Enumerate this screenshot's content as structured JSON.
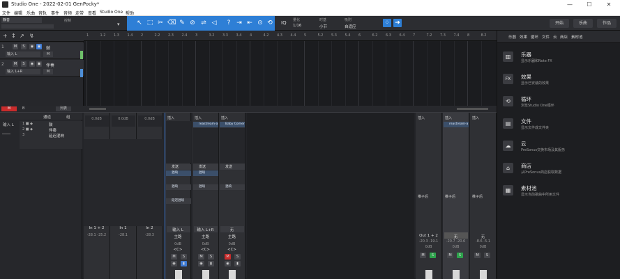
{
  "window": {
    "title": "Studio One - 2022-02-01 GenPocky*",
    "min": "—",
    "max": "☐",
    "close": "✕"
  },
  "menu": [
    "文件",
    "编辑",
    "乐曲",
    "音轨",
    "事件",
    "音频",
    "走带",
    "查看",
    "Studio One",
    "帮助"
  ],
  "toolbar": {
    "preset_name": "静音",
    "control_label": "控制",
    "iq": "IQ",
    "quantize_label": "量化",
    "quantize_val": "1/16",
    "timebase_label": "时基",
    "timebase_val": "小节",
    "snap_label": "吸附",
    "snap_val": "自适应",
    "start": "开始",
    "song": "乐曲",
    "project": "作品"
  },
  "tracks": [
    {
      "num": "1",
      "name": "鼓",
      "input": "输入 L",
      "mode": "M"
    },
    {
      "num": "2",
      "name": "伴奏",
      "input": "输入 L+R",
      "mode": "M"
    }
  ],
  "ruler": [
    "1",
    "1.2",
    "1.3",
    "1.4",
    "2",
    "2.2",
    "2.3",
    "2.4",
    "3",
    "3.2",
    "3.3",
    "3.4",
    "4",
    "4.2",
    "4.3",
    "4.4",
    "5",
    "5.2",
    "5.3",
    "5.4",
    "6",
    "6.2",
    "6.3",
    "6.4",
    "7",
    "7.2",
    "7.3",
    "7.4",
    "8",
    "8.2"
  ],
  "bottom": {
    "m": "M",
    "b": "B",
    "list": "列表"
  },
  "inspector": {
    "channels_label": "通道",
    "group_label": "组",
    "items": [
      "鼓",
      "伴奏",
      "延迟混响"
    ],
    "input_label": "输入 L"
  },
  "mixer": {
    "strips": [
      {
        "db": "0.0dB",
        "name": "In 1 + 2",
        "peak": "-28.1  -25.2"
      },
      {
        "db": "0.0dB",
        "name": "In 1",
        "peak": "-28.1"
      },
      {
        "db": "0.0dB",
        "name": "In 2",
        "peak": "-28.3"
      },
      {
        "insert": "插入",
        "send": "发送",
        "send_item": "混响",
        "src": "输入 L",
        "out": "主路",
        "db": "0dB",
        "pan": "<C>"
      },
      {
        "insert": "插入",
        "plug1": "reastream-a",
        "send": "发送",
        "send_item": "混响",
        "src": "输入 L+R",
        "out": "主路",
        "db": "0dB",
        "pan": "<C>"
      },
      {
        "insert": "插入",
        "plug1": "Baby Comer",
        "send": "发送",
        "send_item": "混响",
        "src": "无",
        "out": "主路",
        "db": "0dB",
        "pan": "<C>"
      }
    ],
    "fx_label": "延迟混响",
    "right": [
      {
        "insert": "插入",
        "send": "推子后",
        "out": "Out 1 + 2",
        "db": "0dB",
        "peak": "-20.3 -19.1"
      },
      {
        "insert": "插入",
        "plug1": "reastream-a",
        "send": "推子后",
        "out": "无",
        "db": "0dB",
        "peak": "-20.7 -20.6"
      },
      {
        "insert": "插入",
        "send": "推子后",
        "out": "无",
        "db": "0dB",
        "peak": "-8.6 -5.1"
      }
    ]
  },
  "browser": {
    "tabs": [
      "乐器",
      "效果",
      "循环",
      "文件",
      "云",
      "商店",
      "素材池"
    ],
    "items": [
      {
        "icon": "piano-icon",
        "glyph": "▥",
        "title": "乐器",
        "sub": "显示乐器和Note FX"
      },
      {
        "icon": "fx-icon",
        "glyph": "FX",
        "title": "效果",
        "sub": "显示已安装的效果"
      },
      {
        "icon": "loop-icon",
        "glyph": "⟲",
        "title": "循环",
        "sub": "浏览Studio One循环"
      },
      {
        "icon": "file-icon",
        "glyph": "▤",
        "title": "文件",
        "sub": "显示文件成文件夹"
      },
      {
        "icon": "cloud-icon",
        "glyph": "☁",
        "title": "云",
        "sub": "PreSonus交换市场及其服务"
      },
      {
        "icon": "shop-icon",
        "glyph": "⌂",
        "title": "商店",
        "sub": "从PreSonus商店获取数据"
      },
      {
        "icon": "pool-icon",
        "glyph": "▦",
        "title": "素材池",
        "sub": "显示当前歌曲中所用文件"
      }
    ]
  }
}
